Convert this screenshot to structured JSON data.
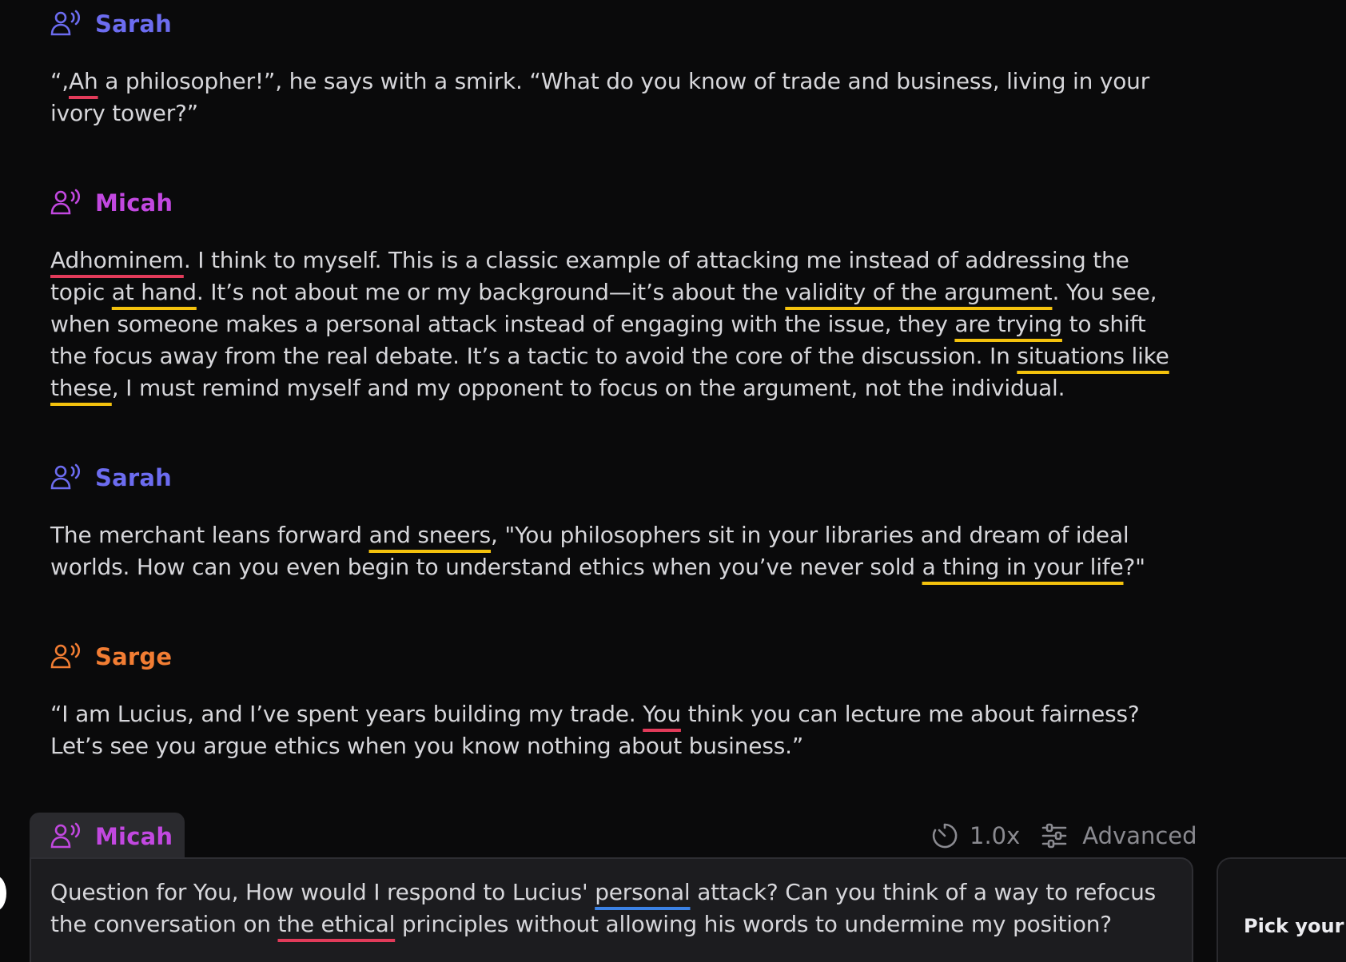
{
  "colors": {
    "sarah": "#6c6cf0",
    "micah": "#c248e0",
    "sarge": "#f27d33",
    "underline_red": "#e23b5a",
    "underline_yellow": "#f4c20d",
    "underline_blue": "#3b82e6"
  },
  "messages": [
    {
      "speaker": "Sarah",
      "icon": "speaking-person-icon",
      "parts": [
        "“,",
        "Ah",
        " a philosopher!”,  he says with a smirk. “What do you know of trade and business, living in your ivory tower?”"
      ]
    },
    {
      "speaker": "Micah",
      "icon": "speaking-person-icon",
      "parts": [
        "Adhominem",
        ". I think to myself. This is a classic example of attacking me instead of addressing the topic ",
        "at hand",
        ". It’s not about me or my background—it’s about the ",
        "validity of the argument",
        ". You see, when someone makes a personal attack instead of engaging with the issue, they ",
        "are trying",
        " to shift the focus away from the real debate. It’s a tactic to avoid the core of the discussion. In ",
        "situations like these",
        ", I must remind myself and my opponent to focus on the argument, not the individual."
      ]
    },
    {
      "speaker": "Sarah",
      "icon": "speaking-person-icon",
      "parts": [
        "The merchant leans forward ",
        "and sneers",
        ", \"You philosophers sit in your libraries and dream of ideal worlds. How can you even begin to understand ethics when you’ve never sold ",
        "a thing in your life",
        "?\""
      ]
    },
    {
      "speaker": "Sarge",
      "icon": "speaking-person-icon",
      "parts": [
        "“I am Lucius, and I’ve spent years building my trade. ",
        "You",
        " think you can lecture me about fairness? Let’s see you argue ethics when you know nothing about business.”"
      ]
    }
  ],
  "composer": {
    "speaker": "Micah",
    "speed_label": "1.0x",
    "advanced_label": "Advanced",
    "parts": [
      "Question for You, How would I respond to Lucius' ",
      "personal",
      " attack? Can you think of a way to refocus the conversation on ",
      "the ethical",
      " principles without allowing his words to undermine my position?"
    ]
  },
  "side_panel": {
    "label": "Pick your p"
  }
}
